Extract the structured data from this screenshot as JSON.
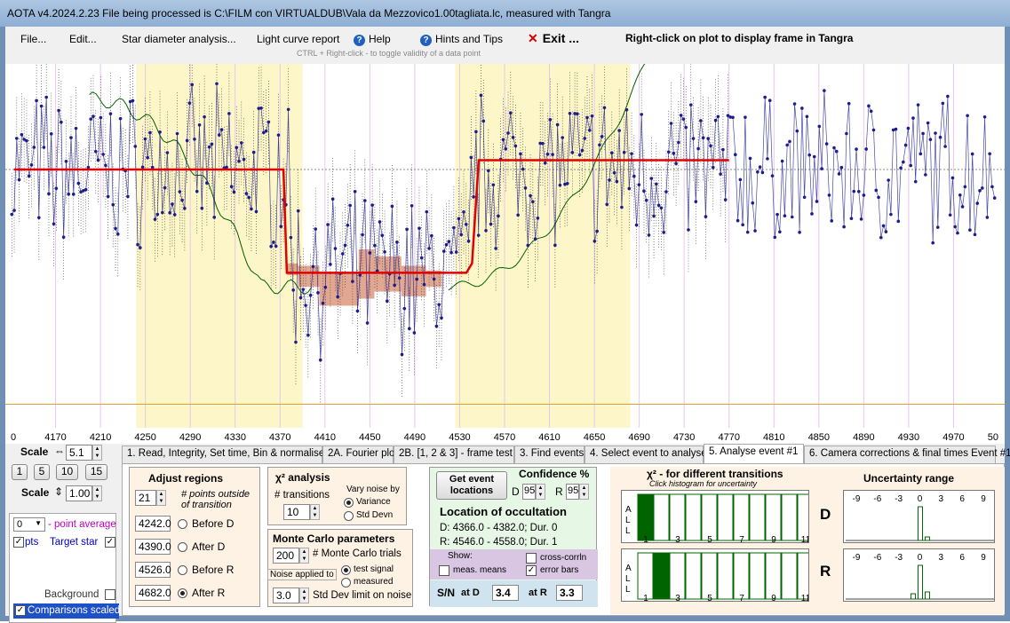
{
  "title": "AOTA v4.2024.2.23    File being processed is C:\\FILM con VIRTUALDUB\\Vala da Mezzovico1.00tagliata.lc, measured with Tangra",
  "menu": {
    "file": "File...",
    "edit": "Edit...",
    "star_diameter": "Star diameter analysis...",
    "light_curve": "Light curve report",
    "help": "Help",
    "hints": "Hints and Tips",
    "exit": "Exit ...",
    "right_click": "Right-click on plot to display frame in Tangra",
    "ctrl_hint": "CTRL + Right-click  -  to toggle validity of a data point"
  },
  "colors": {
    "yellow_band": "#fdf6c8",
    "fit_line": "#e00000",
    "data_line": "#1c1c8c",
    "model_line": "#006000",
    "mc_box": "#d88a6c"
  },
  "chart_data": {
    "type": "line",
    "x_ticks": [
      "0",
      "4170",
      "4210",
      "4250",
      "4290",
      "4330",
      "4370",
      "4410",
      "4450",
      "4490",
      "4530",
      "4570",
      "4610",
      "4650",
      "4690",
      "4730",
      "4770",
      "4810",
      "4850",
      "4890",
      "4930",
      "4970",
      "50"
    ],
    "xlim": [
      4130,
      5010
    ],
    "ylim": [
      -0.1,
      1.45
    ],
    "fit": {
      "x": [
        4133,
        4373,
        4376,
        4379,
        4536,
        4541,
        4547,
        4770
      ],
      "y": [
        1.0,
        1.0,
        0.56,
        0.56,
        0.56,
        0.6,
        1.04,
        1.04
      ]
    },
    "yellow_regions": [
      [
        4242,
        4390
      ],
      [
        4526,
        4682
      ]
    ],
    "mc_boxes": [
      [
        4376,
        4386,
        0.55,
        0.6
      ],
      [
        4386,
        4405,
        0.5,
        0.59
      ],
      [
        4405,
        4440,
        0.42,
        0.56
      ],
      [
        4440,
        4454,
        0.45,
        0.66
      ],
      [
        4454,
        4478,
        0.48,
        0.63
      ],
      [
        4478,
        4500,
        0.46,
        0.59
      ],
      [
        4500,
        4514,
        0.5,
        0.57
      ]
    ]
  },
  "scale": {
    "h_label": "Scale",
    "h_value": "5.1",
    "buttons": [
      "1",
      "5",
      "10",
      "15"
    ],
    "v_label": "Scale",
    "v_value": "1.00",
    "point_avg_value": "0",
    "point_avg_label": "- point average",
    "pts_label": "pts",
    "target_label": "Target star",
    "background_label": "Background",
    "comparisons_label": "Comparisons scaled"
  },
  "tabs": [
    "1.  Read, Integrity, Set time, Bin & normalise",
    "2A. Fourier plot",
    "2B. [1, 2 & 3] - frame test",
    "3. Find events",
    "4. Select event to analyse",
    "5. Analyse event #1",
    "6. Camera corrections & final times Event #1"
  ],
  "adjust": {
    "title": "Adjust regions",
    "points_outside_value": "21",
    "points_outside_label": "# points outside\nof transition",
    "before_d": "4242.0",
    "before_d_label": "Before D",
    "after_d": "4390.0",
    "after_d_label": "After D",
    "before_r": "4526.0",
    "before_r_label": "Before R",
    "after_r": "4682.0",
    "after_r_label": "After R"
  },
  "chi2": {
    "title": "χ² analysis",
    "transitions_label": "# transitions",
    "transitions_value": "10",
    "vary_label": "Vary noise by",
    "variance": "Variance",
    "stddev": "Std Devn"
  },
  "montecarlo": {
    "title": "Monte Carlo parameters",
    "trials_value": "200",
    "trials_label": "# Monte Carlo trials",
    "noise_label": "Noise applied to",
    "test_signal": "test signal",
    "measured": "measured",
    "stddev_value": "3.0",
    "stddev_label": "Std Dev limit on noise"
  },
  "events": {
    "get_button": "Get event locations",
    "confidence_label": "Confidence %",
    "d_label": "D",
    "d_value": "95",
    "r_label": "R",
    "r_value": "95",
    "location_title": "Location of occultation",
    "d_line": "D: 4366.0 - 4382.0; Dur. 0",
    "r_line": "R: 4546.0 - 4558.0; Dur. 1",
    "show_label": "Show:",
    "meas_means": "meas. means",
    "cross_corr": "cross-corrln",
    "error_bars": "error bars",
    "sn_label": "S/N",
    "at_d_label": "at D",
    "at_d_value": "3.4",
    "at_r_label": "at R",
    "at_r_value": "3.3"
  },
  "chi2hist": {
    "title": "χ² - for different transitions",
    "subtitle": "Click histogram for uncertainty",
    "all_label": "A\nL\nL",
    "ticks": [
      "1",
      "3",
      "5",
      "7",
      "9",
      "11"
    ],
    "d_label": "D",
    "r_label": "R"
  },
  "uncert": {
    "title": "Uncertainty range",
    "ticks": [
      "-9",
      "-6",
      "-3",
      "0",
      "3",
      "6",
      "9"
    ]
  }
}
